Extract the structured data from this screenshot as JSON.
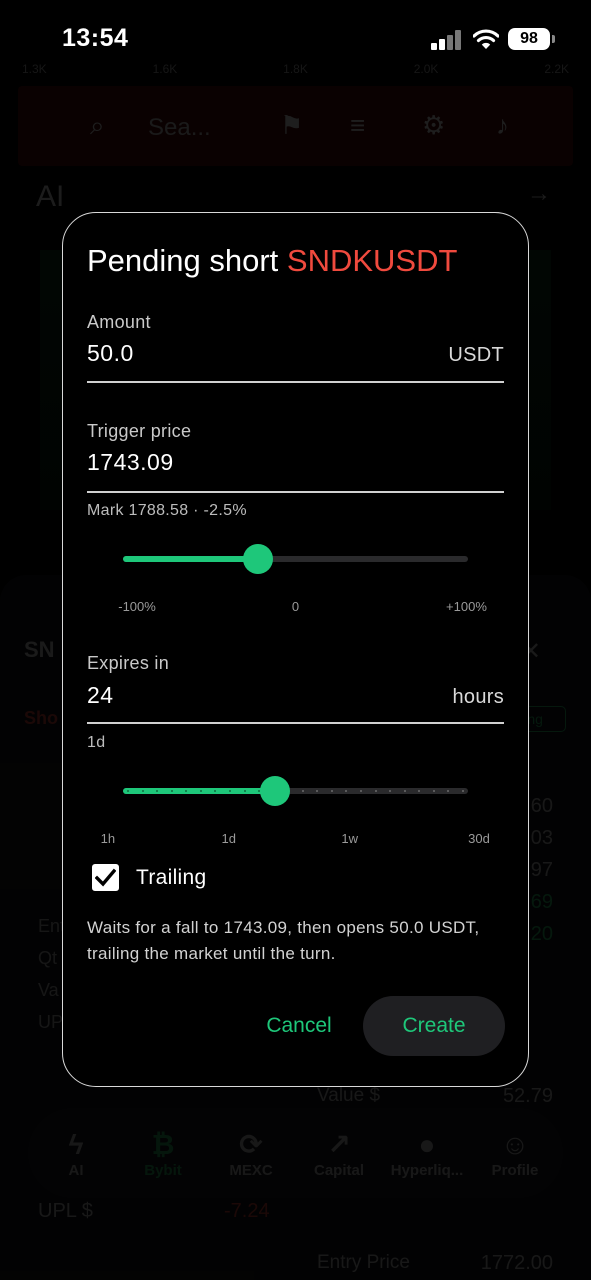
{
  "status_bar": {
    "time": "13:54",
    "battery": "98"
  },
  "background": {
    "axis_ticks": [
      "1.3K",
      "1.6K",
      "1.8K",
      "2.0K",
      "2.2K"
    ],
    "search_placeholder": "Sea...",
    "ai_title": "AI",
    "sheet_title": "SN",
    "short_tab": "Sho",
    "trading_pill": "ling",
    "right_rows": [
      {
        "label": "",
        "value": "60"
      },
      {
        "label": "",
        "value": "03"
      },
      {
        "label": "",
        "value": "97"
      },
      {
        "label": "",
        "value": "69"
      },
      {
        "label": "",
        "value": "20"
      }
    ],
    "left_labels": [
      "Ent",
      "Qt",
      "Va",
      "UP"
    ],
    "value_label": "Value $",
    "value_amount": "52.79",
    "upl_label": "UPL $",
    "upl_value": "-7.24",
    "entry_label": "Entry Price",
    "entry_value": "1772.00",
    "nav": [
      {
        "label": "AI",
        "icon": "bolt-icon"
      },
      {
        "label": "Bybit",
        "icon": "bitcoin-icon"
      },
      {
        "label": "MEXC",
        "icon": "exchange-icon"
      },
      {
        "label": "Capital",
        "icon": "chart-icon"
      },
      {
        "label": "Hyperliq...",
        "icon": "drop-icon"
      },
      {
        "label": "Profile",
        "icon": "person-icon"
      }
    ]
  },
  "dialog": {
    "title_prefix": "Pending short ",
    "symbol": "SNDKUSDT",
    "symbol_color": "#f04a3e",
    "accent_color": "#1ec77a",
    "amount": {
      "label": "Amount",
      "value": "50.0",
      "unit": "USDT"
    },
    "trigger": {
      "label": "Trigger price",
      "value": "1743.09",
      "helper": "Mark 1788.58 · -2.5%",
      "slider_fraction": 0.39,
      "ticks": [
        "-100%",
        "0",
        "+100%"
      ]
    },
    "expires": {
      "label": "Expires in",
      "value": "24",
      "unit": "hours",
      "helper": "1d",
      "slider_fraction": 0.44,
      "ticks": [
        "1h",
        "1d",
        "1w",
        "30d"
      ]
    },
    "trailing": {
      "label": "Trailing",
      "checked": true
    },
    "description": "Waits for a fall to 1743.09, then opens 50.0 USDT, trailing the market until the turn.",
    "cancel_label": "Cancel",
    "create_label": "Create"
  }
}
